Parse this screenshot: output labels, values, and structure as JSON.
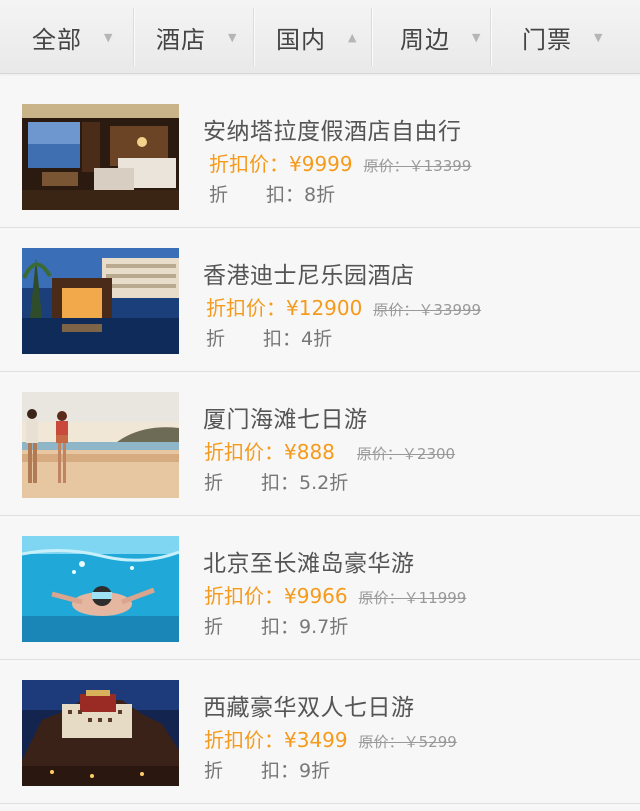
{
  "tabs": [
    {
      "label": "全部",
      "arrow": "▼"
    },
    {
      "label": "酒店",
      "arrow": "▼"
    },
    {
      "label": "国内",
      "arrow": "▲"
    },
    {
      "label": "周边",
      "arrow": "▼"
    },
    {
      "label": "门票",
      "arrow": "▼"
    }
  ],
  "products": [
    {
      "title": "安纳塔拉度假酒店自由行",
      "price_label": "折扣价：¥9999",
      "original_price": "原价：￥13399",
      "discount_prefix": "折",
      "discount_value": "扣：8折"
    },
    {
      "title": "香港迪士尼乐园酒店",
      "price_label": "折扣价：¥12900",
      "original_price": "原价：￥33999",
      "discount_prefix": "折",
      "discount_value": "扣：4折"
    },
    {
      "title": "厦门海滩七日游",
      "price_label": "折扣价：¥888",
      "original_price": "原价：￥2300",
      "discount_prefix": "折",
      "discount_value": "扣：5.2折"
    },
    {
      "title": "北京至长滩岛豪华游",
      "price_label": "折扣价：¥9966",
      "original_price": "原价：￥11999",
      "discount_prefix": "折",
      "discount_value": "扣：9.7折"
    },
    {
      "title": "西藏豪华双人七日游",
      "price_label": "折扣价：¥3499",
      "original_price": "原价：￥5299",
      "discount_prefix": "折",
      "discount_value": "扣：9折"
    }
  ],
  "colors": {
    "price": "#f59a1b",
    "text": "#555555",
    "background": "#f7f7f7"
  }
}
